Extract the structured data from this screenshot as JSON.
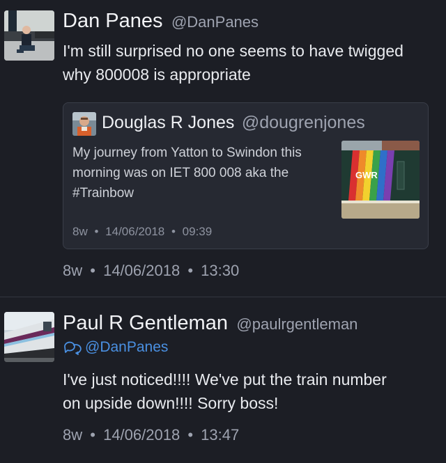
{
  "tweet1": {
    "name": "Dan Panes",
    "handle": "@DanPanes",
    "text_line1": "I'm still surprised no one seems to have twigged",
    "text_line2": "why 800008 is appropriate",
    "age": "8w",
    "date": "14/06/2018",
    "time": "13:30",
    "quote": {
      "name": "Douglas R Jones",
      "handle": "@dougrenjones",
      "text_line1": "My journey from Yatton to Swindon this",
      "text_line2": "morning was on IET 800 008 aka the",
      "text_line3": "#Trainbow",
      "age": "8w",
      "date": "14/06/2018",
      "time": "09:39",
      "thumb_logo": "GWR"
    }
  },
  "tweet2": {
    "name": "Paul R Gentleman",
    "handle": "@paulrgentleman",
    "reply_to": "@DanPanes",
    "text_line1": "I've just noticed!!!! We've put the train number",
    "text_line2": "on upside down!!!! Sorry boss!",
    "age": "8w",
    "date": "14/06/2018",
    "time": "13:47"
  },
  "separator": "•",
  "icons": {
    "reply": "conversation-icon"
  },
  "colors": {
    "background": "#1c1e25",
    "link": "#4a90e2",
    "muted": "#9ea3b0"
  }
}
